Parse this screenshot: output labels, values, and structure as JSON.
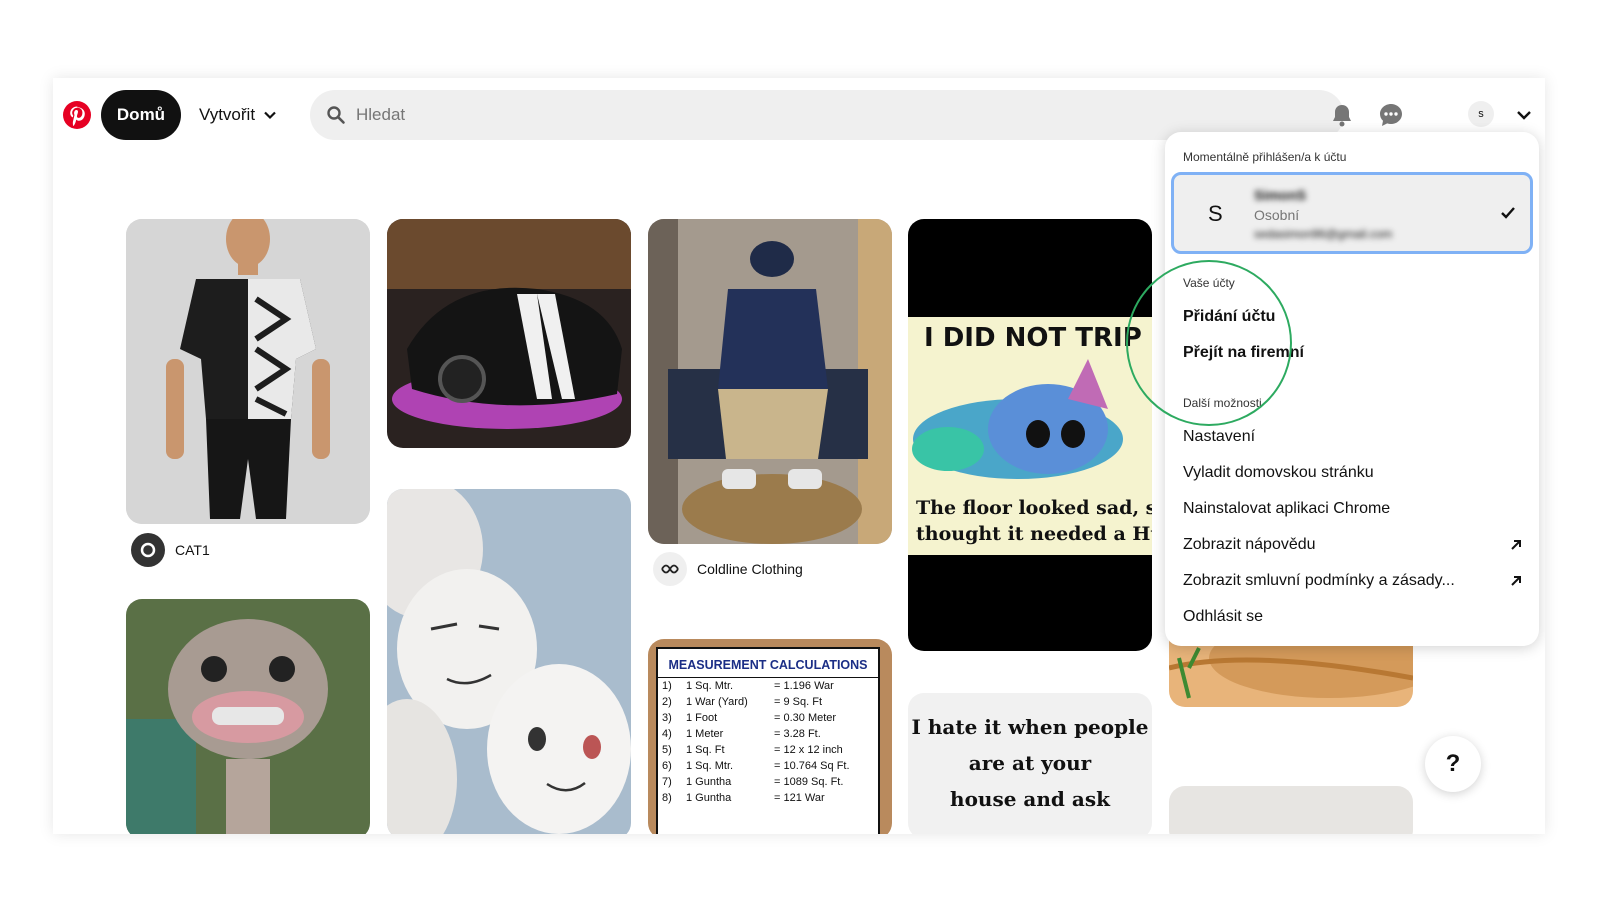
{
  "header": {
    "home_label": "Domů",
    "create_label": "Vytvořit",
    "search_placeholder": "Hledat",
    "avatar_letter": "s"
  },
  "pins": {
    "cat1_name": "CAT1",
    "coldline_name": "Coldline Clothing",
    "meme_trip_top": "I DID NOT TRIP",
    "meme_trip_bottom_1": "The floor looked sad, so I",
    "meme_trip_bottom_2": "thought it needed a Hug",
    "meme_hate_1": "I hate it when people",
    "meme_hate_2": "are at your",
    "meme_hate_3": "house and ask",
    "measurement_title": "MEASUREMENT CALCULATIONS",
    "measurement_rows": [
      {
        "n": "1)",
        "u": "1 Sq. Mtr.",
        "v": "= 1.196 War"
      },
      {
        "n": "2)",
        "u": "1 War (Yard)",
        "v": "= 9 Sq. Ft"
      },
      {
        "n": "3)",
        "u": "1 Foot",
        "v": "= 0.30 Meter"
      },
      {
        "n": "4)",
        "u": "1 Meter",
        "v": "= 3.28 Ft."
      },
      {
        "n": "5)",
        "u": "1 Sq. Ft",
        "v": "= 12 x 12 inch"
      },
      {
        "n": "6)",
        "u": "1 Sq. Mtr.",
        "v": "= 10.764 Sq Ft."
      },
      {
        "n": "7)",
        "u": "1 Guntha",
        "v": "= 1089 Sq. Ft."
      },
      {
        "n": "8)",
        "u": "1 Guntha",
        "v": "= 121 War"
      }
    ]
  },
  "menu": {
    "current_heading": "Momentálně přihlášen/a k účtu",
    "account_letter": "S",
    "account_name": "SimonS",
    "account_type": "Osobní",
    "account_email": "sedasimon96@gmail.com",
    "accounts_heading": "Vaše účty",
    "add_account": "Přidání účtu",
    "switch_business": "Přejít na firemní",
    "more_heading": "Další možnosti",
    "items": [
      "Nastavení",
      "Vyladit domovskou stránku",
      "Nainstalovat aplikaci Chrome",
      "Zobrazit nápovědu",
      "Zobrazit smluvní podmínky a zásady...",
      "Odhlásit se"
    ]
  },
  "help_label": "?",
  "colors": {
    "brand": "#e60023",
    "highlight_border": "#7fb1f5",
    "annotation_circle": "#2daa60"
  }
}
